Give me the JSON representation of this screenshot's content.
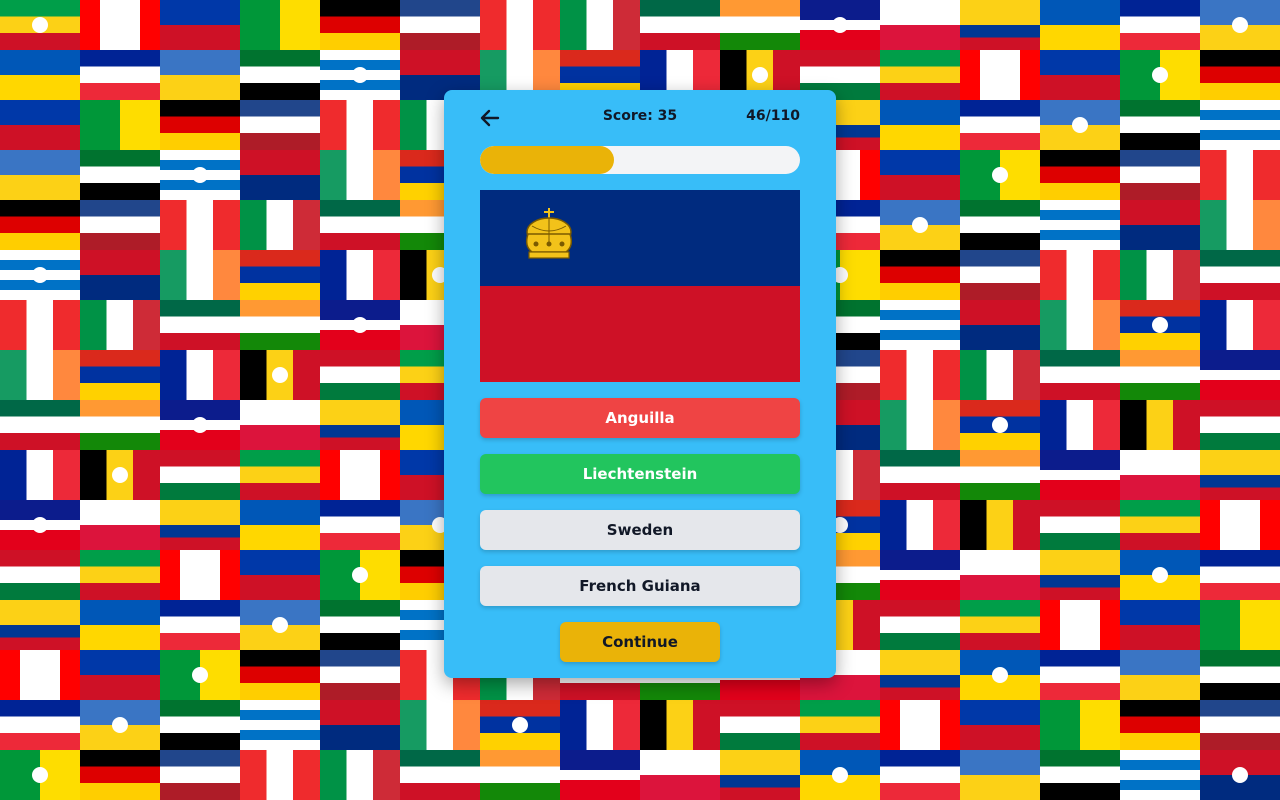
{
  "header": {
    "back_icon": "arrow-left-icon",
    "score_label": "Score: 35",
    "counter_label": "46/110"
  },
  "progress": {
    "fraction": 0.42
  },
  "question": {
    "flag": "Liechtenstein flag",
    "flag_colors": {
      "top": "#002b7f",
      "bottom": "#ce1126",
      "crown": "#f2c21a"
    }
  },
  "answers": [
    {
      "label": "Anguilla",
      "state": "wrong"
    },
    {
      "label": "Liechtenstein",
      "state": "correct"
    },
    {
      "label": "Sweden",
      "state": "neutral"
    },
    {
      "label": "French Guiana",
      "state": "neutral"
    }
  ],
  "continue_label": "Continue",
  "colors": {
    "card": "#38bdf8",
    "accent": "#eab308",
    "wrong": "#ef4444",
    "correct": "#22c55e",
    "neutral": "#e5e7eb"
  }
}
